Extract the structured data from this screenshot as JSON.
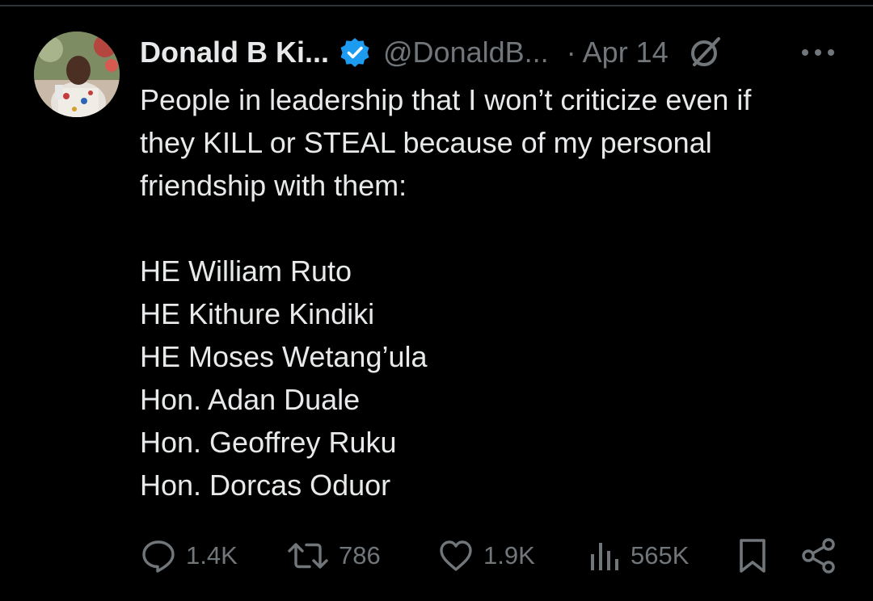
{
  "tweet": {
    "author_name": "Donald B Ki...",
    "handle": "@DonaldB...",
    "separator": "·",
    "date": "Apr 14",
    "verified": true,
    "body_intro_lines": [
      "People in leadership that I won’t criticize even if",
      "they KILL or STEAL because of my personal",
      "friendship with them:"
    ],
    "body_list": [
      "HE William Ruto",
      "HE Kithure Kindiki",
      "HE Moses Wetang’ula",
      "Hon. Adan Duale",
      "Hon. Geoffrey Ruku",
      "Hon. Dorcas Oduor"
    ]
  },
  "actions": {
    "replies": "1.4K",
    "reposts": "786",
    "likes": "1.9K",
    "views": "565K"
  },
  "icons": {
    "verified": "verified-badge-icon",
    "grok": "grok-icon",
    "more": "more-icon",
    "reply": "reply-icon",
    "repost": "repost-icon",
    "like": "heart-icon",
    "views": "views-icon",
    "bookmark": "bookmark-icon",
    "share": "share-icon"
  },
  "colors": {
    "background": "#000000",
    "text": "#e7e9ea",
    "secondary": "#71767b",
    "verified_blue": "#1d9bf0"
  }
}
